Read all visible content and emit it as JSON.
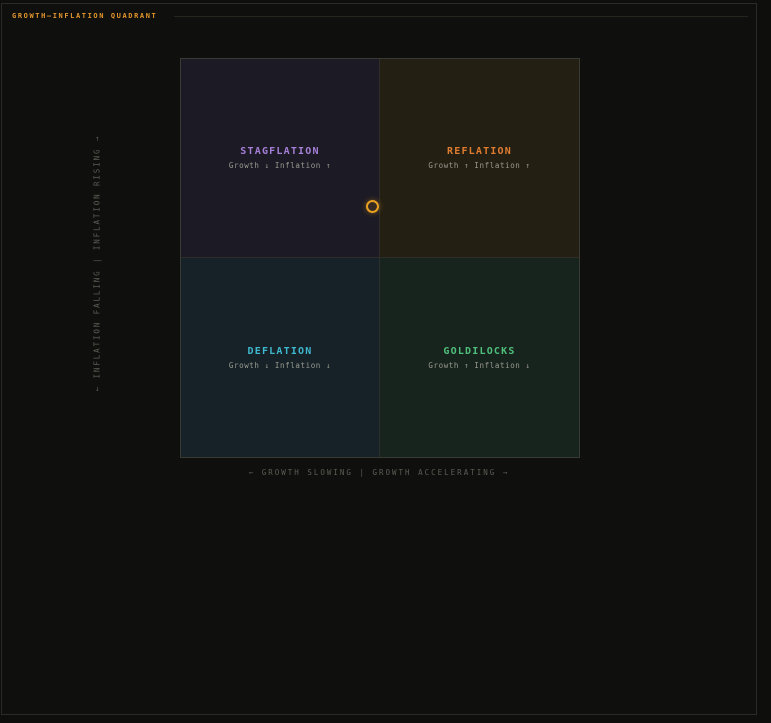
{
  "panel": {
    "title": "GROWTH–INFLATION QUADRANT"
  },
  "axes": {
    "y_label": "← INFLATION FALLING | INFLATION RISING →",
    "x_label": "← GROWTH SLOWING | GROWTH ACCELERATING →"
  },
  "quadrants": [
    {
      "name": "STAGFLATION",
      "desc": "Growth ↓ Inflation ↑",
      "color": "#a57fd8"
    },
    {
      "name": "REFLATION",
      "desc": "Growth ↑ Inflation ↑",
      "color": "#e07c2f"
    },
    {
      "name": "DEFLATION",
      "desc": "Growth ↓ Inflation ↓",
      "color": "#3fb8cf"
    },
    {
      "name": "GOLDILOCKS",
      "desc": "Growth ↑ Inflation ↓",
      "color": "#4fbf7c"
    }
  ],
  "marker": {
    "color": "#e8a020"
  },
  "colors": {
    "accent": "#e2962d",
    "background": "#0f0f0d"
  }
}
